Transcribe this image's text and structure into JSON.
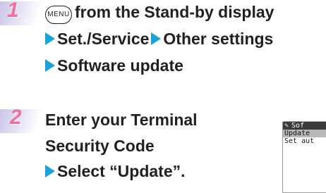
{
  "steps": [
    {
      "number": "1",
      "menu_key": "MENU",
      "line1_text": "from the Stand-by display",
      "line2_part1": "Set./Service",
      "line2_part2": "Other settings",
      "line3_text": "Software update"
    },
    {
      "number": "2",
      "line1_text": "Enter your Terminal",
      "line2_text": "Security Code",
      "line3_text": "Select “Update”."
    }
  ],
  "phone_screen": {
    "title": "Sof",
    "items": [
      "Update",
      "Set aut"
    ]
  },
  "colors": {
    "arrow": "#1aa3d8",
    "step_number": "#ef6fa0",
    "stripe": "#c9c2ea"
  }
}
